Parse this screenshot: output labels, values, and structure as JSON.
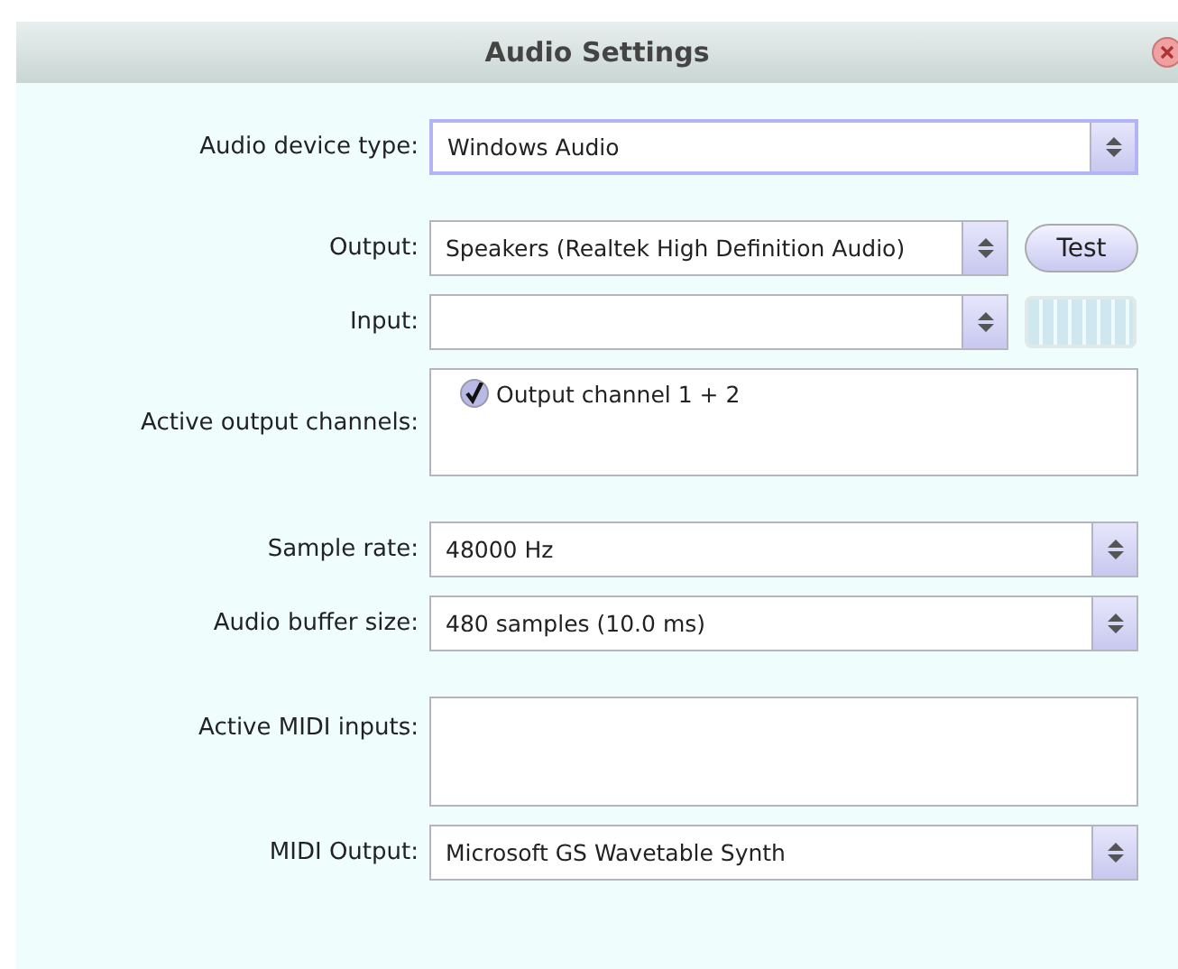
{
  "window": {
    "title": "Audio Settings"
  },
  "rows": [
    {
      "kind": "select",
      "label": "Audio device type:",
      "value": "Windows Audio",
      "focused": true
    },
    {
      "kind": "gap"
    },
    {
      "kind": "select_button",
      "label": "Output:",
      "value": "Speakers (Realtek High Definition Audio)",
      "focused": false,
      "button": "Test"
    },
    {
      "kind": "select_meter",
      "label": "Input:",
      "value": "",
      "focused": false,
      "level": 0
    },
    {
      "kind": "checklist",
      "label": "Active output channels:",
      "items": [
        {
          "label": "Output channel 1 + 2",
          "checked": true
        }
      ]
    },
    {
      "kind": "gap"
    },
    {
      "kind": "select",
      "label": "Sample rate:",
      "value": "48000 Hz",
      "focused": false
    },
    {
      "kind": "select",
      "label": "Audio buffer size:",
      "value": "480 samples (10.0 ms)",
      "focused": false
    },
    {
      "kind": "gap"
    },
    {
      "kind": "list",
      "label": "Active MIDI inputs:"
    },
    {
      "kind": "select",
      "label": "MIDI Output:",
      "value": "Microsoft GS Wavetable Synth",
      "focused": false
    }
  ]
}
